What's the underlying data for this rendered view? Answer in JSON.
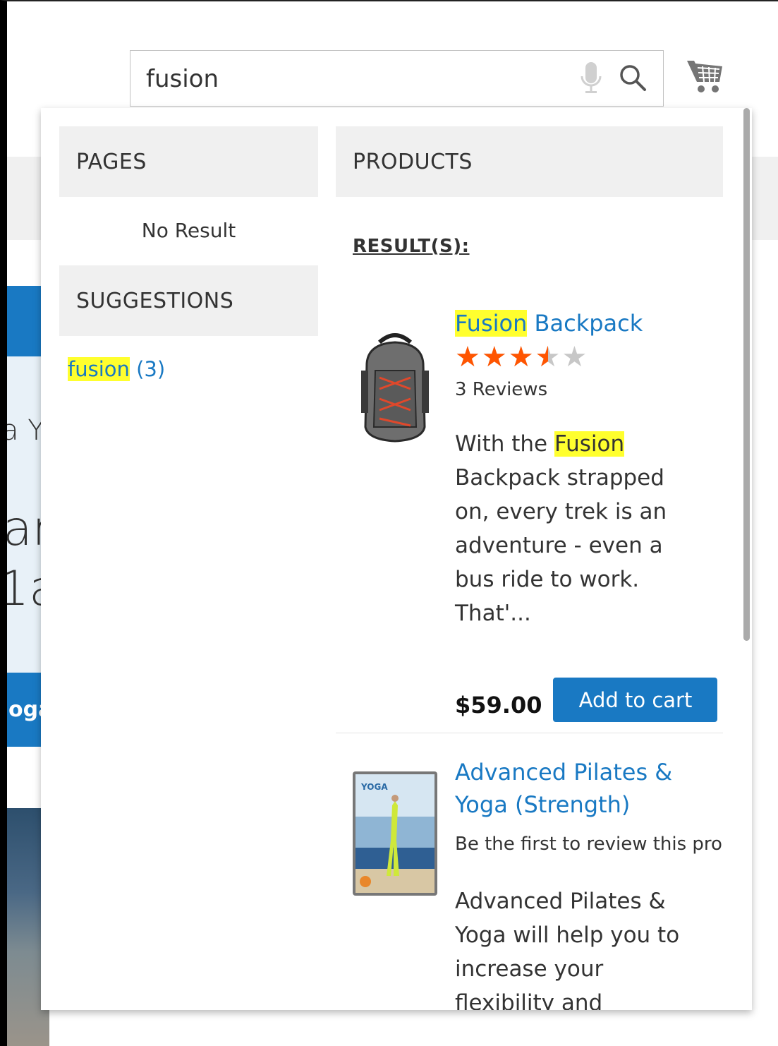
{
  "search": {
    "value": "fusion",
    "mic_icon": "microphone-icon",
    "search_icon": "magnifier-icon"
  },
  "header": {
    "cart_icon": "shopping-cart-icon"
  },
  "background": {
    "hero_text_1": "a Y",
    "hero_text_2": "ar",
    "hero_text_3": "1a",
    "hero_button_fragment": "oga"
  },
  "dropdown": {
    "pages": {
      "heading": "PAGES",
      "empty_text": "No Result"
    },
    "suggestions": {
      "heading": "SUGGESTIONS",
      "items": [
        {
          "term": "fusion",
          "count": "(3)"
        }
      ]
    },
    "products": {
      "heading": "PRODUCTS",
      "results_label": "RESULT(S):",
      "items": [
        {
          "name_highlight": "Fusion",
          "name_rest": " Backpack",
          "rating_percent": 70,
          "stars": "★★★★★",
          "reviews": "3 Reviews",
          "desc_before": "With the ",
          "desc_highlight": "Fusion",
          "desc_after": " Backpack strapped on, every trek is an adventure - even a bus ride to work. That'...",
          "price": "$59.00",
          "add_to_cart": "Add to cart"
        },
        {
          "name": "Advanced Pilates & Yoga (Strength)",
          "review_prompt": "Be the first to review this pro",
          "description": "Advanced Pilates & Yoga will help you to increase your flexibility and"
        }
      ]
    }
  },
  "colors": {
    "accent": "#1979c3",
    "highlight": "#ffff2e",
    "star_filled": "#ff5501",
    "star_empty": "#c7c7c7",
    "section_bg": "#f0f0f0"
  }
}
